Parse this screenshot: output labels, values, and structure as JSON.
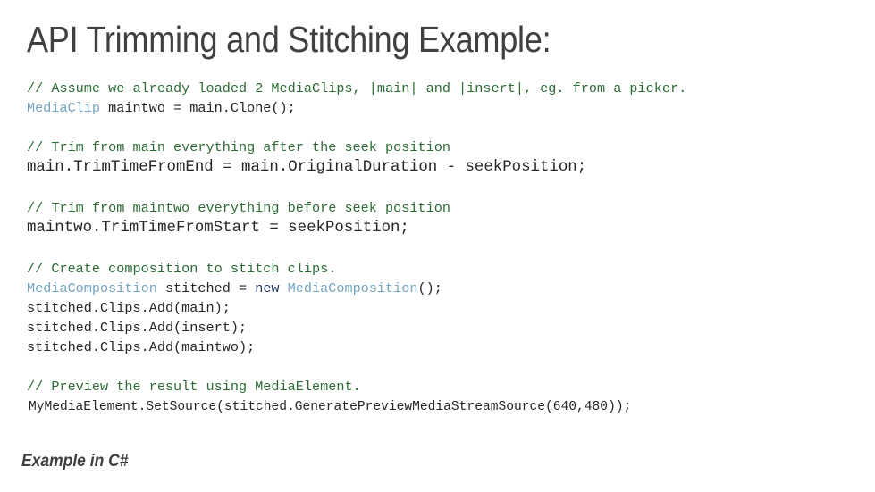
{
  "slide": {
    "title": "API Trimming and Stitching Example:",
    "footer_caption": "Example in C#",
    "background_color": "#FFFFFF",
    "title_color": "#404040",
    "comment_color": "#2C6B35",
    "type_color": "#73A5BF",
    "keyword_color": "#1F3864",
    "code_color": "#262626"
  },
  "code": {
    "block1": {
      "line1_comment": "// Assume we already loaded 2 MediaClips, |main| and |insert|, eg. from a picker.",
      "line2_type": "MediaClip",
      "line2_rest": " maintwo = main.Clone();"
    },
    "block2": {
      "line1_comment": "// Trim from main everything after the seek position",
      "line2_code": "main.TrimTimeFromEnd = main.OriginalDuration - seekPosition;"
    },
    "block3": {
      "line1_comment": "// Trim from maintwo everything before seek position",
      "line2_code": "maintwo.TrimTimeFromStart = seekPosition;"
    },
    "block4": {
      "line1_comment": "// Create composition to stitch clips.",
      "line2_type_a": "MediaComposition",
      "line2_mid": " stitched = ",
      "line2_keyword": "new",
      "line2_type_b": " MediaComposition",
      "line2_end": "();",
      "line3_code": "stitched.Clips.Add(main);",
      "line4_code": "stitched.Clips.Add(insert);",
      "line5_code": "stitched.Clips.Add(maintwo);"
    },
    "block5": {
      "line1_comment": "// Preview the result using MediaElement.",
      "line2_code": "MyMediaElement.SetSource(stitched.GeneratePreviewMediaStreamSource(640,480));"
    }
  }
}
